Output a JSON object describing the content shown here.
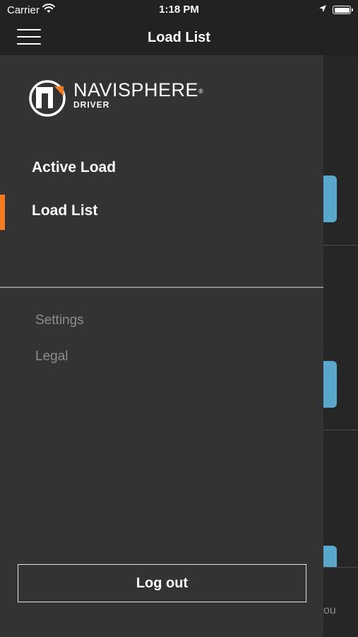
{
  "status_bar": {
    "carrier": "Carrier",
    "time": "1:18 PM"
  },
  "nav_bar": {
    "title": "Load List"
  },
  "drawer": {
    "logo": {
      "brand": "NAVISPHERE",
      "registered": "®",
      "subtitle": "DRIVER"
    },
    "primary_items": [
      {
        "label": "Active Load",
        "selected": false
      },
      {
        "label": "Load List",
        "selected": true
      }
    ],
    "secondary_items": [
      {
        "label": "Settings"
      },
      {
        "label": "Legal"
      }
    ],
    "logout_label": "Log out"
  },
  "background": {
    "partial_text": "ou"
  },
  "colors": {
    "accent": "#f57b20",
    "drawer_bg": "#333333",
    "header_bg": "#222222",
    "card_button": "#5aa7cc",
    "secondary_text": "#8c8c8c"
  }
}
